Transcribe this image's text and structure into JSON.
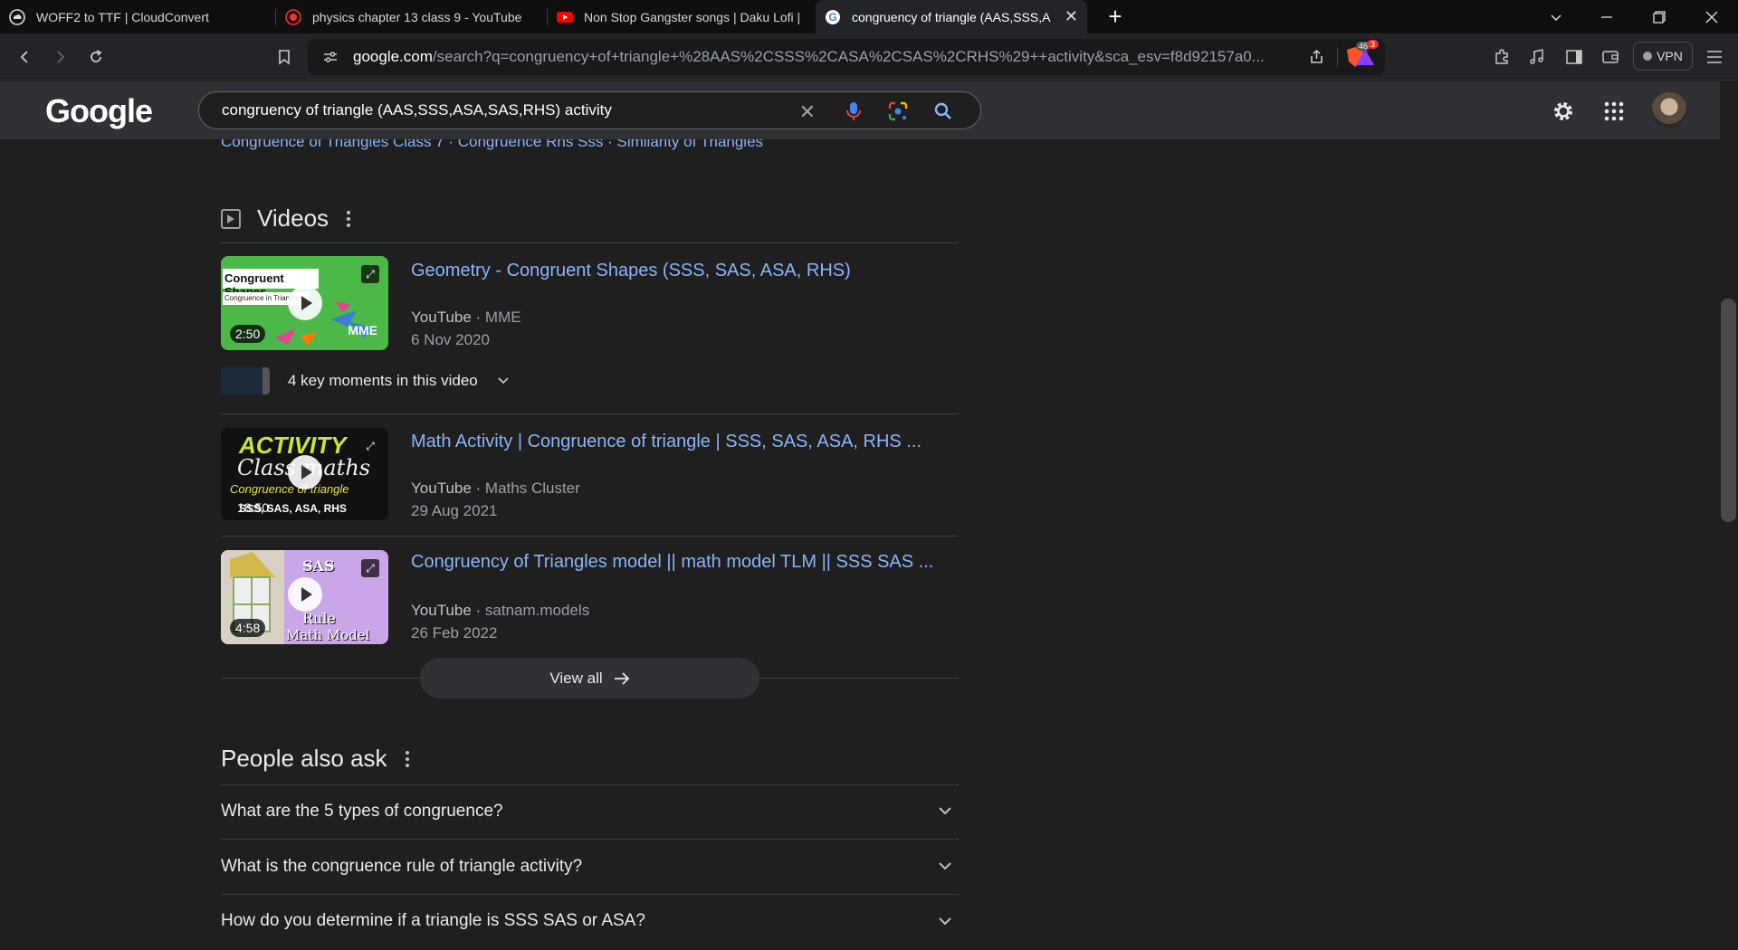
{
  "browser": {
    "tabs": [
      {
        "title": "WOFF2 to TTF | CloudConvert",
        "icon": "cloudconvert-icon"
      },
      {
        "title": "physics chapter 13 class 9 - YouTube",
        "icon": "youtube-recording-icon"
      },
      {
        "title": "Non Stop Gangster songs | Daku Lofi |",
        "icon": "youtube-icon"
      },
      {
        "title": "congruency of triangle (AAS,SSS,A",
        "icon": "google-icon",
        "active": true
      }
    ],
    "url_host": "google.com",
    "url_path": "/search?q=congruency+of+triangle+%28AAS%2CSSS%2CASA%2CSAS%2CRHS%29++activity&sca_esv=f8d92157a0...",
    "brave_badge": "46",
    "alert_badge": "3",
    "vpn_label": "VPN"
  },
  "google": {
    "logo": "Google",
    "query": "congruency of triangle (AAS,SSS,ASA,SAS,RHS)  activity"
  },
  "related_links": "Congruence of Triangles Class 7 · Congruence Rhs Sss · Similarity of Triangles",
  "videos_section": {
    "title": "Videos",
    "items": [
      {
        "title": "Geometry - Congruent Shapes (SSS, SAS, ASA, RHS)",
        "source": "YouTube",
        "channel": "MME",
        "date": "6 Nov 2020",
        "duration": "2:50",
        "thumb_text": "Congruent Shapes",
        "thumb_sub": "Congruence in Triangles",
        "thumb_brand": "MME"
      },
      {
        "title": "Math Activity | Congruence of triangle | SSS, SAS, ASA, RHS ...",
        "source": "YouTube",
        "channel": "Maths Cluster",
        "date": "29 Aug 2021",
        "duration": "18:50",
        "thumb_text": "ACTIVITY",
        "thumb_sub": "Class maths",
        "thumb_line3": "Congruence of triangle",
        "thumb_line4": "SSS, SAS, ASA, RHS"
      },
      {
        "title": "Congruency of Triangles model || math model TLM || SSS SAS ...",
        "source": "YouTube",
        "channel": "satnam.models",
        "date": "26 Feb 2022",
        "duration": "4:58",
        "thumb_text": "SAS",
        "thumb_sub": "Rule",
        "thumb_line3": "Math Model"
      }
    ],
    "key_moments": "4 key moments in this video",
    "view_all": "View all"
  },
  "people_also_ask": {
    "title": "People also ask",
    "questions": [
      "What are the 5 types of congruence?",
      "What is the congruence rule of triangle activity?",
      "How do you determine if a triangle is SSS SAS or ASA?"
    ]
  }
}
